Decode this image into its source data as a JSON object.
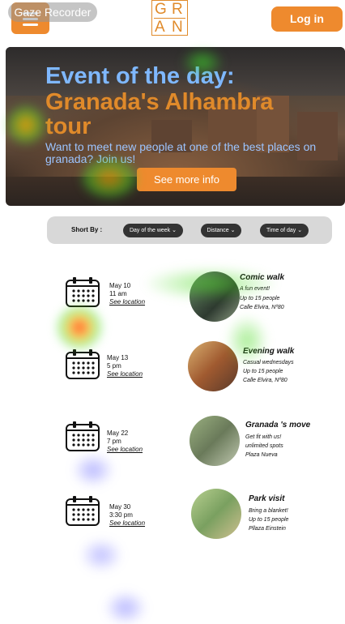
{
  "header": {
    "gaze_label": "Gaze Recorder",
    "logo_row1": [
      "G",
      "R"
    ],
    "logo_row2": [
      "A",
      "N"
    ],
    "login_label": "Log in"
  },
  "hero": {
    "title_line1": "Event of the day:",
    "title_line2": "Granada's Alhambra",
    "title_line3": "tour",
    "subtitle_line1": "Want to meet new people at one of the best places on",
    "subtitle_line2": "granada? Join us!",
    "cta_label": "See more info"
  },
  "filters": {
    "sort_label": "Short By :",
    "chips": [
      "Day of the week ⌄",
      "Distance ⌄",
      "Time of day ⌄"
    ]
  },
  "events": [
    {
      "date": "May 10",
      "time": "11 am",
      "location_link": "See location",
      "title": "Comic walk",
      "lines": [
        "A fun event!",
        "Up to 15 people",
        "Calle Elvira, Nº80"
      ]
    },
    {
      "date": "May 13",
      "time": "5 pm",
      "location_link": "See location",
      "title": "Evening walk",
      "lines": [
        "Casual wednesdays",
        "Up to 15 people",
        "Calle Elvira, Nº80"
      ]
    },
    {
      "date": "May 22",
      "time": "7 pm",
      "location_link": "See location",
      "title": "Granada 's move",
      "lines": [
        "Get fit with us!",
        "unlimited spots",
        "Plaza Nueva"
      ]
    },
    {
      "date": "May 30",
      "time": "3:30 pm",
      "location_link": "See location",
      "title": "Park visit",
      "lines": [
        "Bring a blanket!",
        "Up to 15 people",
        "Pllaza Einstein"
      ]
    }
  ],
  "colors": {
    "accent": "#ee8a2e",
    "hero_title_blue": "#7fb8ff",
    "chip_bg": "#333333"
  }
}
